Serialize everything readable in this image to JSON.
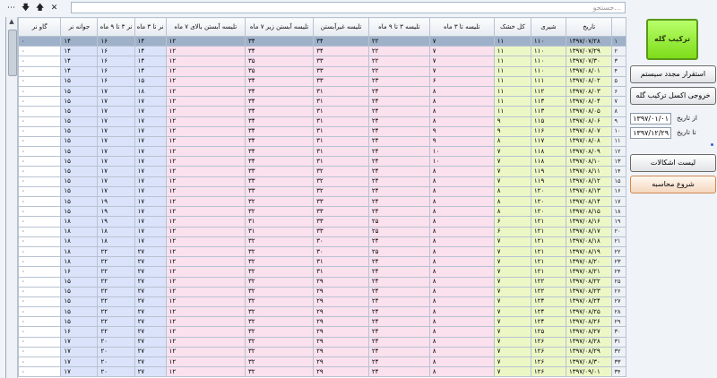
{
  "toolbar": {
    "close_glyph": "✕",
    "down_glyph": "🡇",
    "up_glyph": "🡅",
    "more_glyph": "⋯",
    "search_placeholder": "جستجو..."
  },
  "side": {
    "main_button": "ترکیب گله",
    "btn_refresh": "استقرار مجدد سیستم",
    "btn_excel": "خروجی اکسل ترکیب گله",
    "from_label": "از تاریخ",
    "to_label": "تا تاریخ",
    "from_date": "۱۳۹۷/۰۱/۰۱",
    "to_date": "۱۳۹۷/۱۲/۲۹",
    "btn_errors": "لیست اشکالات",
    "btn_start": "شروع محاسبه"
  },
  "grid": {
    "headers": [
      "گاو نر",
      "جوانه نر",
      "نر ۳ تا ۹ ماه",
      "نر تا ۳ ماه",
      "تلیسه آبستن بالای ۷ ماه",
      "تلیسه آبستن زیر ۷ ماه",
      "تلیسه غیرآبستن",
      "تلیسه ۳ تا ۹ ماه",
      "تلیسه تا ۳ ماه",
      "کل خشک",
      "شیری",
      "تاریخ"
    ],
    "rows": [
      [
        "۰",
        "۱۴",
        "۱۶",
        "۱۴",
        "۱۲",
        "۳۴",
        "۳۴",
        "۲۲",
        "۷",
        "۱۱",
        "۱۱۰",
        "۱۳۹۷/۰۷/۲۸"
      ],
      [
        "۰",
        "۱۴",
        "۱۶",
        "۱۴",
        "۱۲",
        "۳۴",
        "۳۴",
        "۲۲",
        "۷",
        "۱۱",
        "۱۱۰",
        "۱۳۹۷/۰۷/۲۹"
      ],
      [
        "۰",
        "۱۴",
        "۱۶",
        "۱۴",
        "۱۲",
        "۳۵",
        "۳۳",
        "۲۲",
        "۷",
        "۱۱",
        "۱۱۰",
        "۱۳۹۷/۰۷/۳۰"
      ],
      [
        "۰",
        "۱۴",
        "۱۶",
        "۱۴",
        "۱۲",
        "۳۵",
        "۳۳",
        "۲۲",
        "۷",
        "۱۱",
        "۱۱۰",
        "۱۳۹۷/۰۸/۰۱"
      ],
      [
        "۰",
        "۱۵",
        "۱۶",
        "۱۵",
        "۱۲",
        "۳۴",
        "۳۳",
        "۲۳",
        "۶",
        "۱۱",
        "۱۱۱",
        "۱۳۹۷/۰۸/۰۲"
      ],
      [
        "۰",
        "۱۵",
        "۱۷",
        "۱۸",
        "۱۲",
        "۳۴",
        "۳۱",
        "۲۴",
        "۸",
        "۱۱",
        "۱۱۲",
        "۱۳۹۷/۰۸/۰۳"
      ],
      [
        "۰",
        "۱۵",
        "۱۷",
        "۱۷",
        "۱۲",
        "۳۴",
        "۳۱",
        "۲۴",
        "۸",
        "۱۱",
        "۱۱۳",
        "۱۳۹۷/۰۸/۰۴"
      ],
      [
        "۰",
        "۱۵",
        "۱۷",
        "۱۷",
        "۱۲",
        "۳۴",
        "۳۱",
        "۲۴",
        "۸",
        "۱۱",
        "۱۱۳",
        "۱۳۹۷/۰۸/۰۵"
      ],
      [
        "۰",
        "۱۵",
        "۱۷",
        "۱۷",
        "۱۲",
        "۳۴",
        "۳۱",
        "۲۴",
        "۸",
        "۹",
        "۱۱۵",
        "۱۳۹۷/۰۸/۰۶"
      ],
      [
        "۰",
        "۱۵",
        "۱۷",
        "۱۷",
        "۱۲",
        "۳۴",
        "۳۱",
        "۲۴",
        "۹",
        "۹",
        "۱۱۶",
        "۱۳۹۷/۰۸/۰۷"
      ],
      [
        "۰",
        "۱۵",
        "۱۷",
        "۱۷",
        "۱۲",
        "۳۴",
        "۳۱",
        "۲۴",
        "۹",
        "۸",
        "۱۱۷",
        "۱۳۹۷/۰۸/۰۸"
      ],
      [
        "۰",
        "۱۵",
        "۱۷",
        "۱۷",
        "۱۲",
        "۳۴",
        "۳۱",
        "۲۴",
        "۱۰",
        "۷",
        "۱۱۸",
        "۱۳۹۷/۰۸/۰۹"
      ],
      [
        "۰",
        "۱۵",
        "۱۷",
        "۱۷",
        "۱۲",
        "۳۴",
        "۳۱",
        "۲۴",
        "۱۰",
        "۷",
        "۱۱۸",
        "۱۳۹۷/۰۸/۱۰"
      ],
      [
        "۰",
        "۱۵",
        "۱۷",
        "۱۷",
        "۱۲",
        "۳۳",
        "۳۲",
        "۲۴",
        "۸",
        "۷",
        "۱۱۹",
        "۱۳۹۷/۰۸/۱۱"
      ],
      [
        "۰",
        "۱۵",
        "۱۷",
        "۱۷",
        "۱۲",
        "۳۳",
        "۳۲",
        "۲۴",
        "۸",
        "۷",
        "۱۱۹",
        "۱۳۹۷/۰۸/۱۲"
      ],
      [
        "۰",
        "۱۵",
        "۱۷",
        "۱۷",
        "۱۲",
        "۳۳",
        "۳۲",
        "۲۴",
        "۸",
        "۸",
        "۱۲۰",
        "۱۳۹۷/۰۸/۱۳"
      ],
      [
        "۰",
        "۱۵",
        "۱۹",
        "۱۷",
        "۱۲",
        "۳۲",
        "۳۳",
        "۲۴",
        "۸",
        "۸",
        "۱۲۰",
        "۱۳۹۷/۰۸/۱۴"
      ],
      [
        "۰",
        "۱۵",
        "۱۹",
        "۱۷",
        "۱۲",
        "۳۲",
        "۳۳",
        "۲۴",
        "۸",
        "۸",
        "۱۲۰",
        "۱۳۹۷/۰۸/۱۵"
      ],
      [
        "۰",
        "۱۸",
        "۱۹",
        "۱۷",
        "۱۲",
        "۳۱",
        "۳۳",
        "۲۵",
        "۸",
        "۶",
        "۱۲۱",
        "۱۳۹۷/۰۸/۱۶"
      ],
      [
        "۰",
        "۱۸",
        "۱۸",
        "۱۷",
        "۱۲",
        "۳۱",
        "۳۳",
        "۲۵",
        "۸",
        "۶",
        "۱۲۱",
        "۱۳۹۷/۰۸/۱۷"
      ],
      [
        "۰",
        "۱۸",
        "۱۸",
        "۱۷",
        "۱۲",
        "۳۲",
        "۳۰",
        "۲۴",
        "۸",
        "۷",
        "۱۲۱",
        "۱۳۹۷/۰۸/۱۸"
      ],
      [
        "۰",
        "۱۸",
        "۲۲",
        "۲۷",
        "۱۲",
        "۳۲",
        "۳۰",
        "۲۵",
        "۸",
        "۷",
        "۱۲۱",
        "۱۳۹۷/۰۸/۱۹"
      ],
      [
        "۰",
        "۱۸",
        "۲۲",
        "۲۷",
        "۱۲",
        "۳۲",
        "۳۱",
        "۲۴",
        "۸",
        "۷",
        "۱۲۱",
        "۱۳۹۷/۰۸/۲۰"
      ],
      [
        "۰",
        "۱۶",
        "۲۲",
        "۲۷",
        "۱۲",
        "۳۲",
        "۳۱",
        "۲۴",
        "۸",
        "۷",
        "۱۲۱",
        "۱۳۹۷/۰۸/۲۱"
      ],
      [
        "۰",
        "۱۵",
        "۲۲",
        "۲۷",
        "۱۲",
        "۳۲",
        "۲۹",
        "۲۴",
        "۸",
        "۷",
        "۱۲۲",
        "۱۳۹۷/۰۸/۲۲"
      ],
      [
        "۰",
        "۱۵",
        "۲۲",
        "۲۷",
        "۱۲",
        "۳۲",
        "۲۹",
        "۲۴",
        "۸",
        "۷",
        "۱۲۲",
        "۱۳۹۷/۰۸/۲۳"
      ],
      [
        "۰",
        "۱۵",
        "۲۲",
        "۲۷",
        "۱۲",
        "۳۲",
        "۲۹",
        "۲۴",
        "۸",
        "۷",
        "۱۲۴",
        "۱۳۹۷/۰۸/۲۴"
      ],
      [
        "۰",
        "۱۵",
        "۲۲",
        "۲۷",
        "۱۲",
        "۳۲",
        "۲۹",
        "۲۴",
        "۸",
        "۷",
        "۱۲۴",
        "۱۳۹۷/۰۸/۲۵"
      ],
      [
        "۰",
        "۱۵",
        "۲۲",
        "۲۷",
        "۱۲",
        "۳۲",
        "۲۹",
        "۲۴",
        "۸",
        "۷",
        "۱۲۴",
        "۱۳۹۷/۰۸/۲۶"
      ],
      [
        "۰",
        "۱۶",
        "۲۲",
        "۲۷",
        "۱۲",
        "۳۲",
        "۲۹",
        "۲۴",
        "۸",
        "۷",
        "۱۲۵",
        "۱۳۹۷/۰۸/۲۷"
      ],
      [
        "۰",
        "۱۷",
        "۲۰",
        "۲۷",
        "۱۲",
        "۳۲",
        "۲۹",
        "۲۴",
        "۸",
        "۷",
        "۱۲۶",
        "۱۳۹۷/۰۸/۲۸"
      ],
      [
        "۰",
        "۱۷",
        "۲۰",
        "۲۷",
        "۱۲",
        "۳۲",
        "۲۹",
        "۲۴",
        "۸",
        "۷",
        "۱۲۶",
        "۱۳۹۷/۰۸/۲۹"
      ],
      [
        "۰",
        "۱۷",
        "۲۰",
        "۲۷",
        "۱۲",
        "۳۲",
        "۲۹",
        "۲۴",
        "۸",
        "۷",
        "۱۲۶",
        "۱۳۹۷/۰۸/۳۰"
      ],
      [
        "۰",
        "۱۷",
        "۲۰",
        "۲۷",
        "۱۲",
        "۳۲",
        "۲۹",
        "۲۴",
        "۸",
        "۷",
        "۱۲۶",
        "۱۳۹۷/۰۹/۰۱"
      ]
    ],
    "row_numbers": [
      "۱",
      "۲",
      "۳",
      "۴",
      "۵",
      "۶",
      "۷",
      "۸",
      "۹",
      "۱۰",
      "۱۱",
      "۱۲",
      "۱۳",
      "۱۴",
      "۱۵",
      "۱۶",
      "۱۷",
      "۱۸",
      "۱۹",
      "۲۰",
      "۲۱",
      "۲۲",
      "۲۳",
      "۲۴",
      "۲۵",
      "۲۶",
      "۲۷",
      "۲۸",
      "۲۹",
      "۳۰",
      "۳۱",
      "۳۲",
      "۳۳",
      "۳۴"
    ]
  }
}
